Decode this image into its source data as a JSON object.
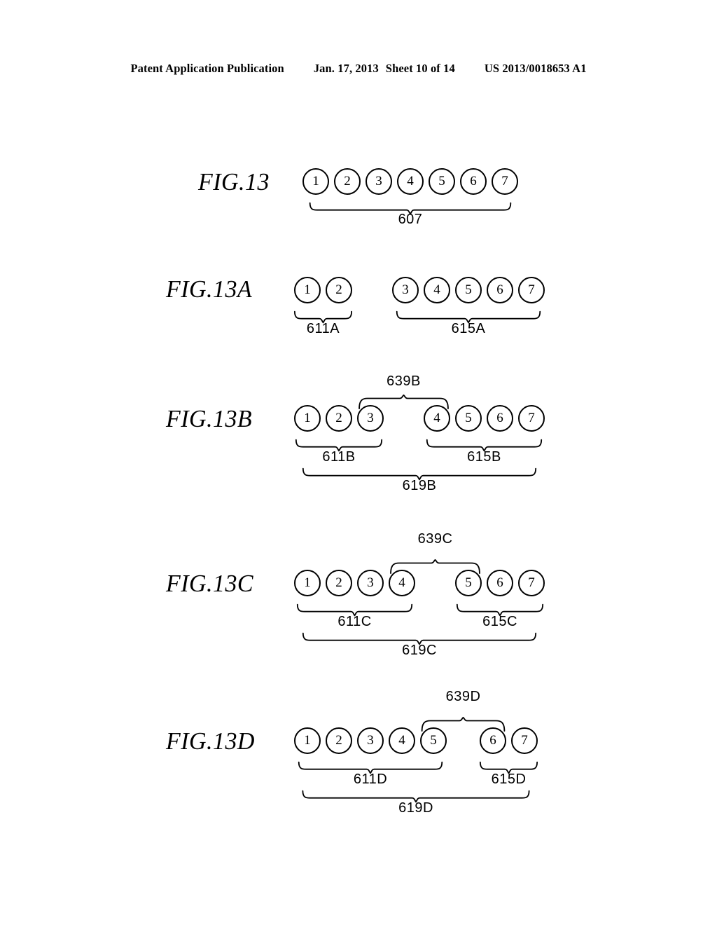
{
  "header": {
    "publication": "Patent Application Publication",
    "date": "Jan. 17, 2013",
    "sheet": "Sheet 10 of 14",
    "docnum": "US 2013/0018653 A1"
  },
  "figures": [
    {
      "label": "FIG.13",
      "circles": [
        "1",
        "2",
        "3",
        "4",
        "5",
        "6",
        "7"
      ],
      "braces_below": [
        {
          "ref": "607",
          "covers": [
            "1",
            "2",
            "3",
            "4",
            "5",
            "6",
            "7"
          ]
        }
      ],
      "braces_above": [],
      "brace_total": null
    },
    {
      "label": "FIG.13A",
      "circles": [
        "1",
        "2",
        "3",
        "4",
        "5",
        "6",
        "7"
      ],
      "braces_below": [
        {
          "ref": "611A",
          "covers": [
            "1",
            "2"
          ]
        },
        {
          "ref": "615A",
          "covers": [
            "3",
            "4",
            "5",
            "6",
            "7"
          ]
        }
      ],
      "braces_above": [],
      "brace_total": null
    },
    {
      "label": "FIG.13B",
      "circles": [
        "1",
        "2",
        "3",
        "4",
        "5",
        "6",
        "7"
      ],
      "braces_below": [
        {
          "ref": "611B",
          "covers": [
            "1",
            "2",
            "3"
          ]
        },
        {
          "ref": "615B",
          "covers": [
            "4",
            "5",
            "6",
            "7"
          ]
        }
      ],
      "braces_above": [
        {
          "ref": "639B",
          "covers": [
            "3",
            "4"
          ]
        }
      ],
      "brace_total": {
        "ref": "619B",
        "covers": [
          "1",
          "2",
          "3",
          "4",
          "5",
          "6",
          "7"
        ]
      }
    },
    {
      "label": "FIG.13C",
      "circles": [
        "1",
        "2",
        "3",
        "4",
        "5",
        "6",
        "7"
      ],
      "braces_below": [
        {
          "ref": "611C",
          "covers": [
            "1",
            "2",
            "3",
            "4"
          ]
        },
        {
          "ref": "615C",
          "covers": [
            "5",
            "6",
            "7"
          ]
        }
      ],
      "braces_above": [
        {
          "ref": "639C",
          "covers": [
            "4",
            "5"
          ]
        }
      ],
      "brace_total": {
        "ref": "619C",
        "covers": [
          "1",
          "2",
          "3",
          "4",
          "5",
          "6",
          "7"
        ]
      }
    },
    {
      "label": "FIG.13D",
      "circles": [
        "1",
        "2",
        "3",
        "4",
        "5",
        "6",
        "7"
      ],
      "braces_below": [
        {
          "ref": "611D",
          "covers": [
            "1",
            "2",
            "3",
            "4",
            "5"
          ]
        },
        {
          "ref": "615D",
          "covers": [
            "6",
            "7"
          ]
        }
      ],
      "braces_above": [
        {
          "ref": "639D",
          "covers": [
            "5",
            "6"
          ]
        }
      ],
      "brace_total": {
        "ref": "619D",
        "covers": [
          "1",
          "2",
          "3",
          "4",
          "5",
          "6",
          "7"
        ]
      }
    }
  ],
  "colors": {
    "ink": "#000000",
    "paper": "#ffffff"
  }
}
